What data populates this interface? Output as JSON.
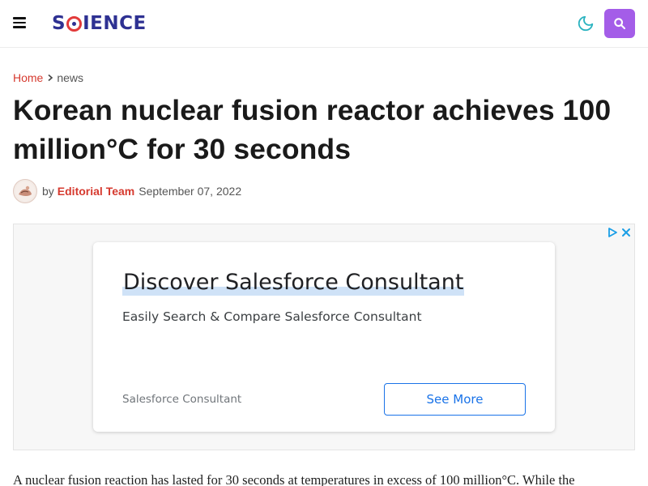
{
  "header": {
    "logo_text_pre": "S",
    "logo_text_post": "IENCE",
    "menu_icon": "hamburger-menu-icon",
    "dark_mode_icon": "moon-icon",
    "search_icon": "search-icon",
    "search_button_color": "#a45de8"
  },
  "breadcrumb": {
    "home": "Home",
    "current": "news"
  },
  "article": {
    "title": "Korean nuclear fusion reactor achieves 100 million°C for 30 seconds",
    "by": "by",
    "author": "Editorial Team",
    "date": "September 07, 2022",
    "first_paragraph": "A nuclear fusion reaction has lasted for 30 seconds at temperatures in excess of 100 million°C. While the"
  },
  "ad": {
    "headline": "Discover Salesforce Consultant",
    "description": "Easily Search & Compare Salesforce Consultant",
    "source": "Salesforce Consultant",
    "cta": "See More"
  },
  "colors": {
    "accent_red": "#d63a2f",
    "logo_blue": "#2e3192",
    "ad_link_blue": "#1a73e8"
  }
}
